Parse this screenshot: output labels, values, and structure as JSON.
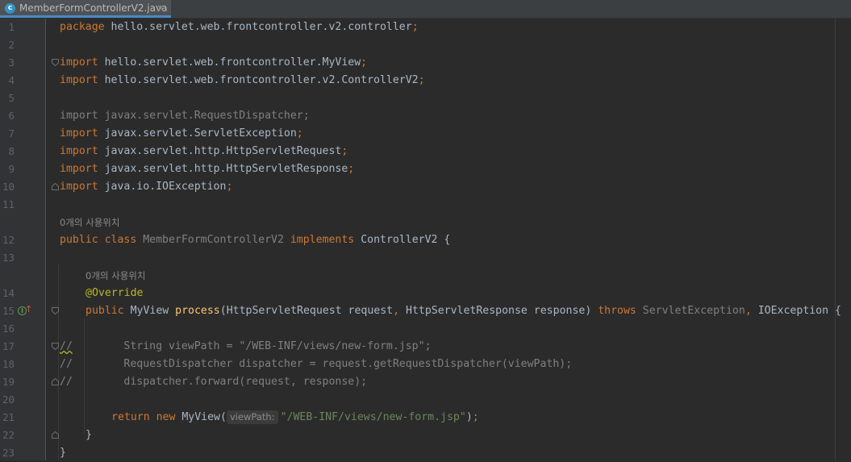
{
  "tab": {
    "title": "MemberFormControllerV2.java",
    "icon": "class-file-icon",
    "icon_letter": "c",
    "close_glyph": "×"
  },
  "hints": {
    "usage_class": "0개의 사용위치",
    "usage_method": "0개의 사용위치",
    "param_viewPath": "viewPath:"
  },
  "lines": {
    "l1": {
      "num": "1",
      "t": [
        "package",
        " hello.servlet.web.frontcontroller.v2.controller",
        ";"
      ]
    },
    "l2": {
      "num": "2"
    },
    "l3": {
      "num": "3",
      "t": [
        "import",
        " hello.servlet.web.frontcontroller.MyView",
        ";"
      ]
    },
    "l4": {
      "num": "4",
      "t": [
        "import",
        " hello.servlet.web.frontcontroller.v2.ControllerV2",
        ";"
      ]
    },
    "l5": {
      "num": "5"
    },
    "l6": {
      "num": "6",
      "t": [
        "import javax.servlet.RequestDispatcher;"
      ]
    },
    "l7": {
      "num": "7",
      "t": [
        "import",
        " javax.servlet.ServletException",
        ";"
      ]
    },
    "l8": {
      "num": "8",
      "t": [
        "import",
        " javax.servlet.http.HttpServletRequest",
        ";"
      ]
    },
    "l9": {
      "num": "9",
      "t": [
        "import",
        " javax.servlet.http.HttpServletResponse",
        ";"
      ]
    },
    "l10": {
      "num": "10",
      "t": [
        "import",
        " java.io.IOException",
        ";"
      ]
    },
    "l11": {
      "num": "11"
    },
    "l12": {
      "num": "12",
      "t": [
        "public class",
        " MemberFormControllerV2 ",
        "implements",
        " ControllerV2 {"
      ]
    },
    "l13": {
      "num": "13"
    },
    "l14": {
      "num": "14",
      "t": [
        "@Override"
      ]
    },
    "l15": {
      "num": "15",
      "t": [
        "public",
        " MyView ",
        "process",
        "(HttpServletRequest request",
        ", ",
        "HttpServletResponse response) ",
        "throws",
        " ServletException",
        ", ",
        "IOException {"
      ]
    },
    "l16": {
      "num": "16"
    },
    "l17": {
      "num": "17",
      "t": [
        "//",
        "        String viewPath = \"/WEB-INF/views/new-form.jsp\";"
      ]
    },
    "l18": {
      "num": "18",
      "t": [
        "//        RequestDispatcher dispatcher = request.getRequestDispatcher(viewPath);"
      ]
    },
    "l19": {
      "num": "19",
      "t": [
        "//        dispatcher.forward(request, response);"
      ]
    },
    "l20": {
      "num": "20"
    },
    "l21": {
      "num": "21",
      "t": [
        "return new",
        " MyView(",
        "\"/WEB-INF/views/new-form.jsp\"",
        ")",
        ";"
      ]
    },
    "l22": {
      "num": "22",
      "t": [
        "}"
      ]
    },
    "l23": {
      "num": "23",
      "t": [
        "}"
      ]
    }
  },
  "colors": {
    "background": "#2b2b2b",
    "keyword": "#cc7832",
    "string": "#6a8759",
    "method": "#ffc66d",
    "annotation": "#bbb529",
    "text": "#a9b7c6",
    "comment": "#808080"
  }
}
